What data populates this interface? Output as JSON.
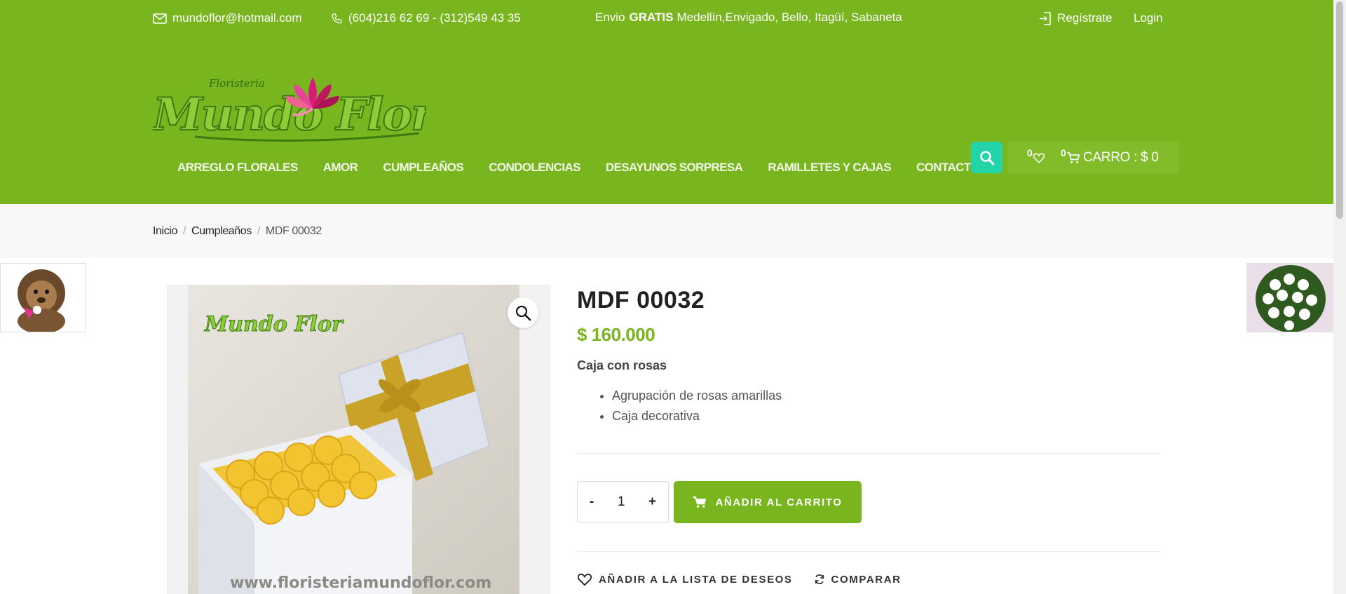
{
  "topbar": {
    "email": "mundoflor@hotmail.com",
    "phone": "(604)216 62 69 - (312)549 43 35",
    "shipping_prefix": "Envio",
    "shipping_bold": "GRATIS",
    "shipping_rest": "Medellín,Envigado, Bello, Itagüí, Sabaneta",
    "register": "Regístrate",
    "login": "Login"
  },
  "brand": {
    "small": "Floristeria",
    "name": "Mundo Flor"
  },
  "nav": [
    "ARREGLO FLORALES",
    "AMOR",
    "CUMPLEAÑOS",
    "CONDOLENCIAS",
    "DESAYUNOS SORPRESA",
    "RAMILLETES Y CAJAS",
    "CONTACTO"
  ],
  "header_tools": {
    "wishlist_count": "0",
    "cart_count": "0",
    "cart_label": "CARRO : $ 0"
  },
  "breadcrumb": {
    "home": "Inicio",
    "sep": "/",
    "category": "Cumpleaños",
    "current": "MDF 00032"
  },
  "product": {
    "title": "MDF 00032",
    "price": "$ 160.000",
    "desc_head": "Caja con rosas",
    "bullets": [
      "Agrupación de rosas amarillas",
      "Caja decorativa"
    ],
    "qty_minus": "-",
    "qty_value": "1",
    "qty_plus": "+",
    "add_to_cart": "AÑADIR AL CARRITO",
    "wishlist": "AÑADIR A LA LISTA DE DESEOS",
    "compare": "COMPARAR"
  },
  "photo": {
    "watermark": "www.floristeriamundoflor.com"
  },
  "colors": {
    "brand_green": "#79b51f",
    "accent_teal": "#23d4a9",
    "rose_yellow": "#f4c430"
  }
}
